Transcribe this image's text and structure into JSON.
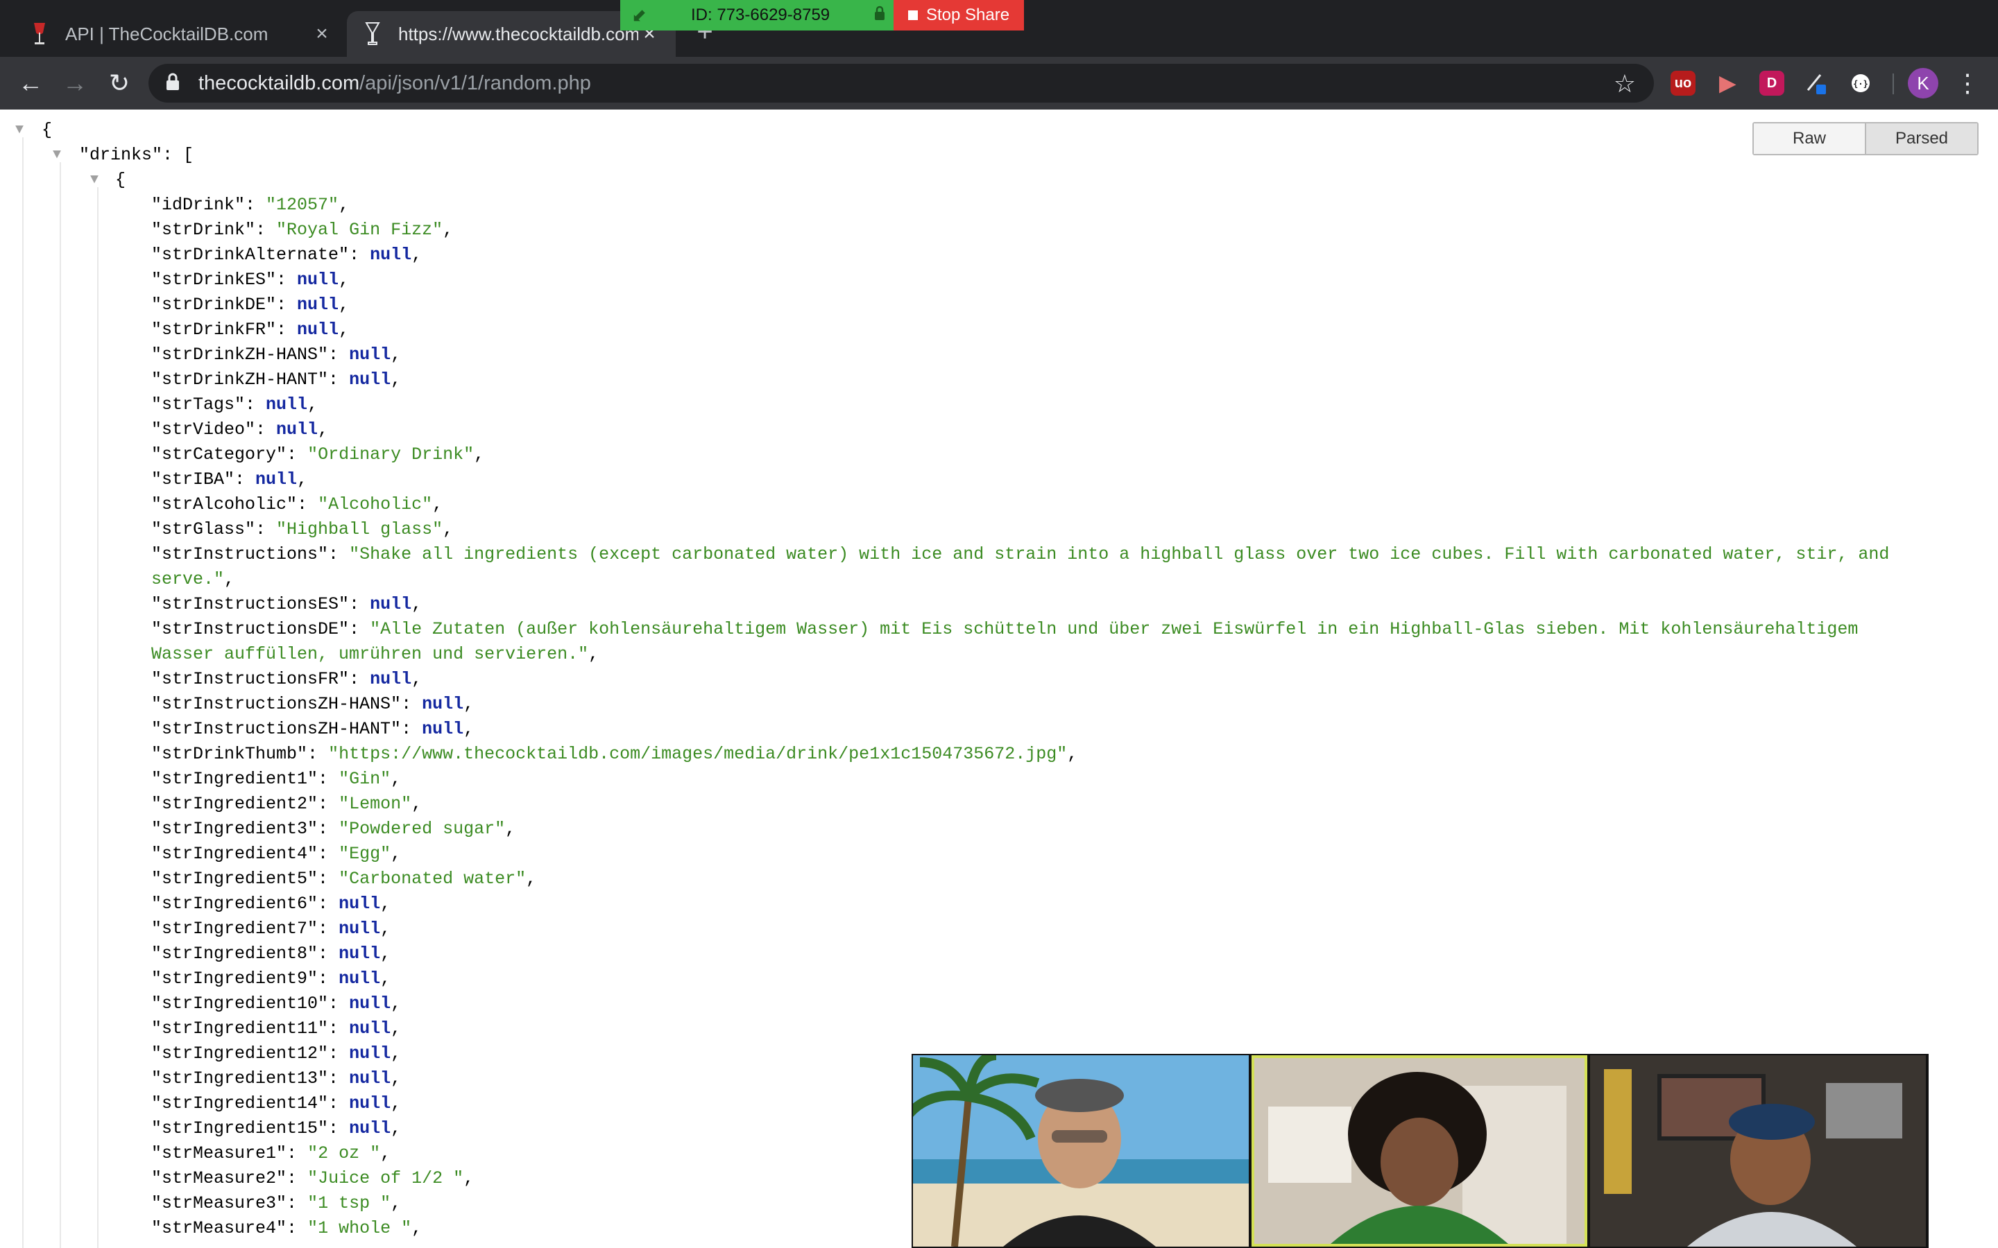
{
  "browser": {
    "tabs": [
      {
        "title": "API | TheCocktailDB.com",
        "active": false
      },
      {
        "title": "https://www.thecocktaildb.com/api/json/v1/1/random.php",
        "active": true
      }
    ],
    "new_tab_label": "+",
    "url_host": "thecocktaildb.com",
    "url_path": "/api/json/v1/1/random.php",
    "extensions": [
      "ublock-icon",
      "video-extension-icon",
      "d-extension-icon",
      "pen-extension-icon",
      "json-extension-icon"
    ],
    "profile_initial": "K"
  },
  "share_banner": {
    "meeting_id": "ID: 773-6629-8759",
    "stop_label": "Stop Share"
  },
  "viewer": {
    "raw_label": "Raw",
    "parsed_label": "Parsed",
    "active_mode": "Parsed"
  },
  "json": {
    "root_key": "drinks",
    "fields": [
      {
        "key": "idDrink",
        "value": "12057",
        "type": "string"
      },
      {
        "key": "strDrink",
        "value": "Royal Gin Fizz",
        "type": "string"
      },
      {
        "key": "strDrinkAlternate",
        "value": "null",
        "type": "null"
      },
      {
        "key": "strDrinkES",
        "value": "null",
        "type": "null"
      },
      {
        "key": "strDrinkDE",
        "value": "null",
        "type": "null"
      },
      {
        "key": "strDrinkFR",
        "value": "null",
        "type": "null"
      },
      {
        "key": "strDrinkZH-HANS",
        "value": "null",
        "type": "null"
      },
      {
        "key": "strDrinkZH-HANT",
        "value": "null",
        "type": "null"
      },
      {
        "key": "strTags",
        "value": "null",
        "type": "null"
      },
      {
        "key": "strVideo",
        "value": "null",
        "type": "null"
      },
      {
        "key": "strCategory",
        "value": "Ordinary Drink",
        "type": "string"
      },
      {
        "key": "strIBA",
        "value": "null",
        "type": "null"
      },
      {
        "key": "strAlcoholic",
        "value": "Alcoholic",
        "type": "string"
      },
      {
        "key": "strGlass",
        "value": "Highball glass",
        "type": "string"
      },
      {
        "key": "strInstructions",
        "value": "Shake all ingredients (except carbonated water) with ice and strain into a highball glass over two ice cubes. Fill with carbonated water, stir, and serve.",
        "type": "string",
        "wrap": "Shake all ingredients (except carbonated water) with ice and strain into a highball glass over two ice cubes. Fill with carbonated water, stir, and|serve."
      },
      {
        "key": "strInstructionsES",
        "value": "null",
        "type": "null"
      },
      {
        "key": "strInstructionsDE",
        "value": "Alle Zutaten (außer kohlensäurehaltigem Wasser) mit Eis schütteln und über zwei Eiswürfel in ein Highball-Glas sieben. Mit kohlensäurehaltigem Wasser auffüllen, umrühren und servieren.",
        "type": "string",
        "wrap": "Alle Zutaten (außer kohlensäurehaltigem Wasser) mit Eis schütteln und über zwei Eiswürfel in ein Highball-Glas sieben. Mit kohlensäurehaltigem|Wasser auffüllen, umrühren und servieren."
      },
      {
        "key": "strInstructionsFR",
        "value": "null",
        "type": "null"
      },
      {
        "key": "strInstructionsZH-HANS",
        "value": "null",
        "type": "null"
      },
      {
        "key": "strInstructionsZH-HANT",
        "value": "null",
        "type": "null"
      },
      {
        "key": "strDrinkThumb",
        "value": "https://www.thecocktaildb.com/images/media/drink/pe1x1c1504735672.jpg",
        "type": "string"
      },
      {
        "key": "strIngredient1",
        "value": "Gin",
        "type": "string"
      },
      {
        "key": "strIngredient2",
        "value": "Lemon",
        "type": "string"
      },
      {
        "key": "strIngredient3",
        "value": "Powdered sugar",
        "type": "string"
      },
      {
        "key": "strIngredient4",
        "value": "Egg",
        "type": "string"
      },
      {
        "key": "strIngredient5",
        "value": "Carbonated water",
        "type": "string"
      },
      {
        "key": "strIngredient6",
        "value": "null",
        "type": "null"
      },
      {
        "key": "strIngredient7",
        "value": "null",
        "type": "null"
      },
      {
        "key": "strIngredient8",
        "value": "null",
        "type": "null"
      },
      {
        "key": "strIngredient9",
        "value": "null",
        "type": "null"
      },
      {
        "key": "strIngredient10",
        "value": "null",
        "type": "null"
      },
      {
        "key": "strIngredient11",
        "value": "null",
        "type": "null"
      },
      {
        "key": "strIngredient12",
        "value": "null",
        "type": "null"
      },
      {
        "key": "strIngredient13",
        "value": "null",
        "type": "null"
      },
      {
        "key": "strIngredient14",
        "value": "null",
        "type": "null"
      },
      {
        "key": "strIngredient15",
        "value": "null",
        "type": "null"
      },
      {
        "key": "strMeasure1",
        "value": "2 oz ",
        "type": "string"
      },
      {
        "key": "strMeasure2",
        "value": "Juice of 1/2 ",
        "type": "string"
      },
      {
        "key": "strMeasure3",
        "value": "1 tsp ",
        "type": "string"
      },
      {
        "key": "strMeasure4",
        "value": "1 whole ",
        "type": "string"
      }
    ]
  },
  "video_tiles": [
    {
      "name": "participant-1",
      "speaking": false,
      "backdrop": "beach"
    },
    {
      "name": "participant-2",
      "speaking": true,
      "backdrop": "room"
    },
    {
      "name": "participant-3",
      "speaking": false,
      "backdrop": "office"
    }
  ],
  "colors": {
    "string": "#3b8b22",
    "null": "#1428a0",
    "tabstrip": "#202124",
    "toolbar": "#35363a",
    "share_green": "#39b54a",
    "stop_red": "#e53935"
  }
}
